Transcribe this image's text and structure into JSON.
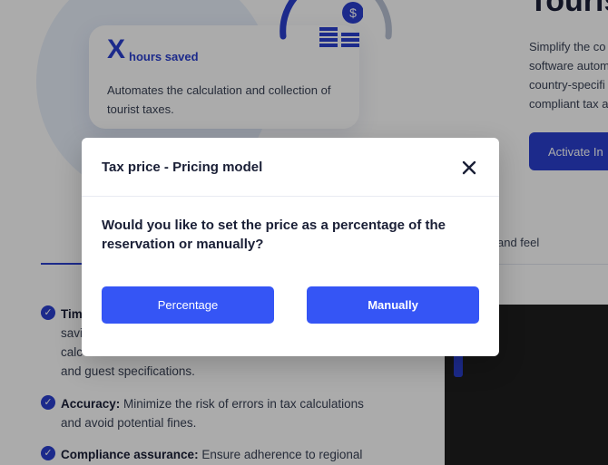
{
  "background": {
    "card": {
      "x_mark": "X",
      "hours_label": "hours saved",
      "description": "Automates the calculation and collection of tourist taxes."
    },
    "hero": {
      "title": "Touris",
      "lines": [
        "Simplify the co",
        "software autom",
        "country-specifi",
        "compliant tax a"
      ],
      "activate_label": "Activate In"
    },
    "tabs": {
      "partial_label": "and feel"
    },
    "features": [
      {
        "bold": "Tim",
        "rest": "",
        "lines": [
          "savi",
          "calc",
          "and guest specifications."
        ]
      },
      {
        "bold": "Accuracy:",
        "rest": " Minimize the risk of errors in tax calculations",
        "lines": [
          "and avoid potential fines."
        ]
      },
      {
        "bold": "Compliance assurance:",
        "rest": " Ensure adherence to regional",
        "lines": []
      }
    ]
  },
  "modal": {
    "title": "Tax price - Pricing model",
    "question": "Would you like to set the price as a percentage of the reservation or manually?",
    "buttons": {
      "percentage": "Percentage",
      "manually": "Manually"
    }
  },
  "colors": {
    "accent": "#3555f5",
    "brand_dark": "#2a3fd0",
    "overlay": "rgba(0,0,0,0.33)"
  },
  "icons": {
    "close": "close-icon",
    "check": "check-circle-icon",
    "coin": "dollar-coin-icon"
  }
}
